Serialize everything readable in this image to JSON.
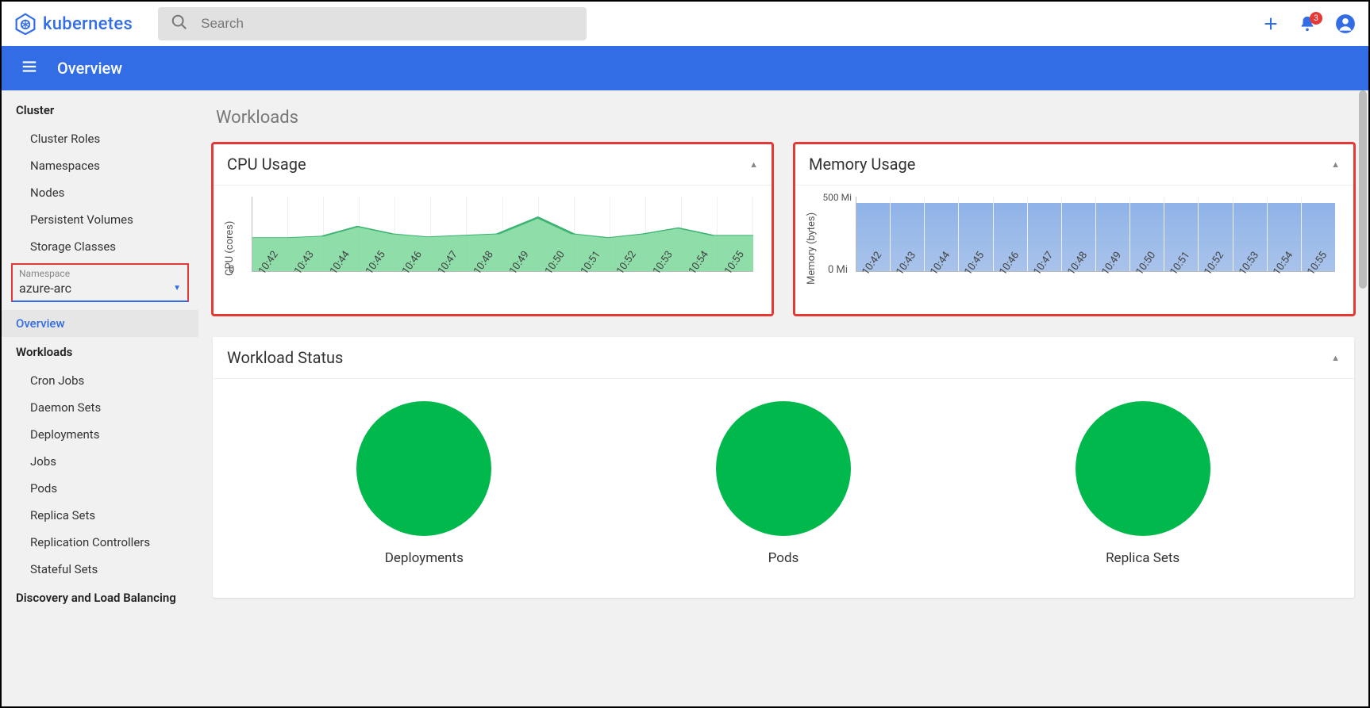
{
  "brand": {
    "name": "kubernetes"
  },
  "search": {
    "placeholder": "Search"
  },
  "notifications": {
    "count": "3"
  },
  "bluebar": {
    "title": "Overview"
  },
  "sidebar": {
    "cluster_heading": "Cluster",
    "cluster_items": [
      "Cluster Roles",
      "Namespaces",
      "Nodes",
      "Persistent Volumes",
      "Storage Classes"
    ],
    "namespace_label": "Namespace",
    "namespace_value": "azure-arc",
    "overview_item": "Overview",
    "workloads_heading": "Workloads",
    "workloads_items": [
      "Cron Jobs",
      "Daemon Sets",
      "Deployments",
      "Jobs",
      "Pods",
      "Replica Sets",
      "Replication Controllers",
      "Stateful Sets"
    ],
    "discovery_heading": "Discovery and Load Balancing"
  },
  "page": {
    "title": "Workloads"
  },
  "cpu_card": {
    "title": "CPU Usage",
    "ylabel": "CPU (cores)",
    "tick_bottom": "0"
  },
  "mem_card": {
    "title": "Memory Usage",
    "ylabel": "Memory (bytes)",
    "tick_top": "500 Mi",
    "tick_bottom": "0 Mi"
  },
  "status": {
    "title": "Workload Status",
    "items": [
      "Deployments",
      "Pods",
      "Replica Sets"
    ]
  },
  "chart_data": [
    {
      "type": "area",
      "title": "CPU Usage",
      "ylabel": "CPU (cores)",
      "ylim": [
        0,
        1
      ],
      "categories": [
        "10:42",
        "10:43",
        "10:44",
        "10:45",
        "10:46",
        "10:47",
        "10:48",
        "10:49",
        "10:50",
        "10:51",
        "10:52",
        "10:53",
        "10:54",
        "10:55"
      ],
      "values": [
        0.45,
        0.45,
        0.47,
        0.6,
        0.5,
        0.46,
        0.48,
        0.5,
        0.72,
        0.5,
        0.45,
        0.5,
        0.58,
        0.48
      ]
    },
    {
      "type": "area",
      "title": "Memory Usage",
      "ylabel": "Memory (bytes)",
      "ylim": [
        0,
        500
      ],
      "unit": "Mi",
      "categories": [
        "10:42",
        "10:43",
        "10:44",
        "10:45",
        "10:46",
        "10:47",
        "10:48",
        "10:49",
        "10:50",
        "10:51",
        "10:52",
        "10:53",
        "10:54",
        "10:55"
      ],
      "values": [
        460,
        460,
        460,
        460,
        460,
        460,
        460,
        460,
        460,
        460,
        460,
        460,
        460,
        460
      ]
    }
  ]
}
